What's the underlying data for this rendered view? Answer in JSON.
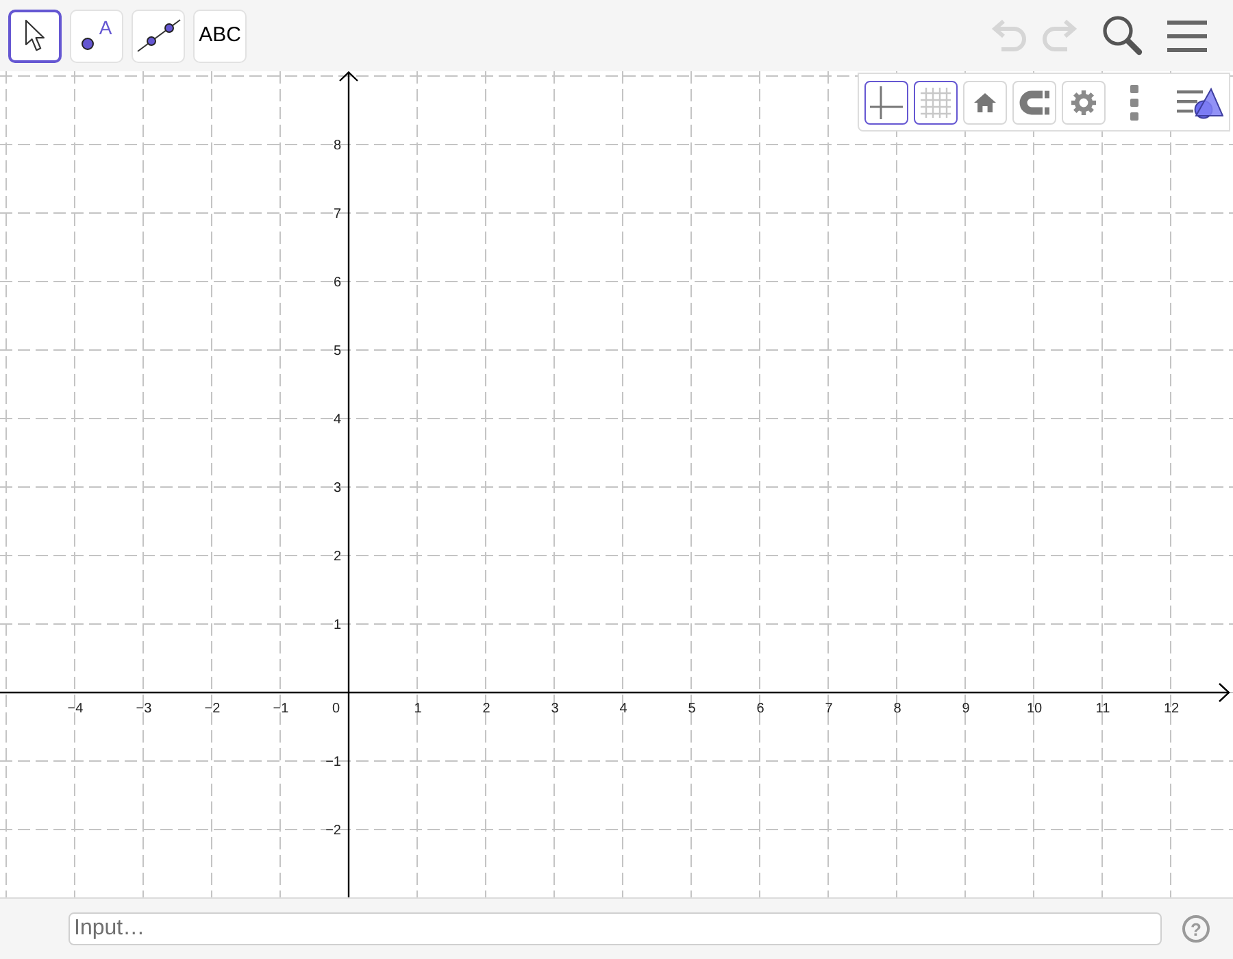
{
  "toolbar": {
    "tools": [
      {
        "kind": "move",
        "selected": true
      },
      {
        "kind": "point",
        "selected": false,
        "label": "A"
      },
      {
        "kind": "segment",
        "selected": false
      },
      {
        "kind": "text",
        "selected": false,
        "label": "ABC"
      }
    ],
    "undo": {
      "disabled": true
    },
    "redo": {
      "disabled": true
    }
  },
  "style_bar": {
    "buttons": [
      {
        "kind": "axes",
        "selected": true
      },
      {
        "kind": "grid",
        "selected": true
      },
      {
        "kind": "home",
        "selected": false
      },
      {
        "kind": "magnet",
        "selected": false
      },
      {
        "kind": "settings",
        "selected": false
      }
    ]
  },
  "graphics": {
    "y_labels_positive": [
      "8",
      "7",
      "6",
      "5",
      "4",
      "3",
      "2",
      "1"
    ],
    "x_labels_negative": [
      "−4",
      "−3",
      "−2",
      "−1"
    ],
    "origin_label": "0",
    "x_labels_positive": [
      "1",
      "2",
      "3",
      "4",
      "5",
      "6",
      "7",
      "8",
      "9",
      "10",
      "11",
      "12"
    ],
    "y_labels_negative": [
      "−1",
      "−2"
    ]
  },
  "input_bar": {
    "placeholder": "Input…",
    "help": "?"
  }
}
